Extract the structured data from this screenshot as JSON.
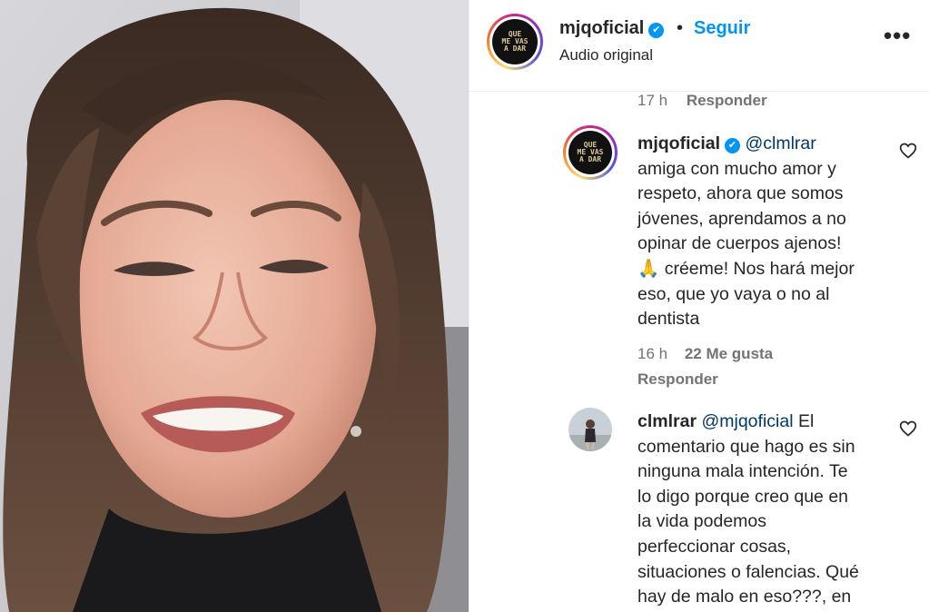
{
  "header": {
    "username": "mjqoficial",
    "verified_mark": "✔",
    "separator": "•",
    "follow_label": "Seguir",
    "audio_label": "Audio original",
    "more_label": "•••",
    "logo_lines": [
      "QUE",
      "ME VAS",
      "A DAR"
    ]
  },
  "prev_comment_meta": {
    "time": "17 h",
    "reply": "Responder"
  },
  "comments": [
    {
      "username": "mjqoficial",
      "verified_mark": "✔",
      "mention": "@clmlrar",
      "text_lines": [
        "amiga con mucho amor y",
        "respeto, ahora que somos",
        "jóvenes, aprendamos a no",
        "opinar de cuerpos ajenos!",
        "🙏 créeme! Nos hará mejor",
        "eso, que yo vaya o no al",
        "dentista"
      ],
      "time": "16 h",
      "likes": "22 Me gusta",
      "reply": "Responder",
      "logo_lines": [
        "QUE",
        "ME VAS",
        "A DAR"
      ]
    },
    {
      "username": "clmlrar",
      "mention": "@mjqoficial",
      "first_line_tail": "El",
      "text_lines": [
        "comentario que hago es sin",
        "ninguna mala intención. Te",
        "lo digo porque creo que en",
        "la vida podemos",
        "perfeccionar cosas,",
        "situaciones o falencias. Qué",
        "hay de malo en eso???, en"
      ]
    }
  ],
  "colors": {
    "link_blue": "#0095f6",
    "mention_blue": "#00376b",
    "meta_gray": "#737373"
  },
  "icons": [
    "verified-badge-icon",
    "more-options-icon",
    "heart-icon"
  ]
}
